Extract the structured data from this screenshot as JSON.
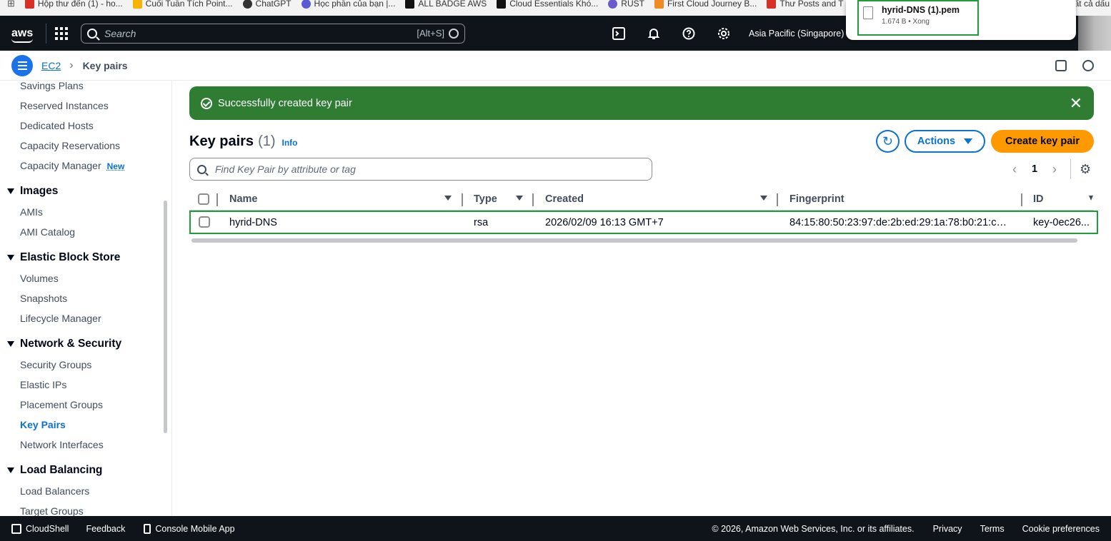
{
  "bookmarks": [
    {
      "label": "Hộp thư đến (1) - ho...",
      "color": "#d93025"
    },
    {
      "label": "Cuối Tuần Tích Point...",
      "color": "#f4b400"
    },
    {
      "label": "ChatGPT",
      "color": "#333333"
    },
    {
      "label": "Học phần của bạn |...",
      "color": "#5b5bd6"
    },
    {
      "label": "ALL BADGE AWS",
      "color": "#111111"
    },
    {
      "label": "Cloud Essentials Khó...",
      "color": "#111111"
    },
    {
      "label": "RUST",
      "color": "#6a5acd"
    },
    {
      "label": "First Cloud Journey B...",
      "color": "#f08a24"
    },
    {
      "label": "Thư Posts and T",
      "color": "#d93025"
    },
    {
      "label": "ất cả dấu",
      "color": "#f3f3f3"
    }
  ],
  "topnav": {
    "logo": "aws",
    "search_placeholder": "Search",
    "search_shortcut": "[Alt+S]",
    "region": "Asia Pacific (Singapore)"
  },
  "download": {
    "filename": "hyrid-DNS (1).pem",
    "meta": "1.674 B • Xong"
  },
  "breadcrumb": {
    "parent": "EC2",
    "current": "Key pairs"
  },
  "sidebar": {
    "items_top": [
      "Savings Plans",
      "Reserved Instances",
      "Dedicated Hosts",
      "Capacity Reservations",
      "Capacity Manager"
    ],
    "new_badge": "New",
    "images": {
      "title": "Images",
      "items": [
        "AMIs",
        "AMI Catalog"
      ]
    },
    "ebs": {
      "title": "Elastic Block Store",
      "items": [
        "Volumes",
        "Snapshots",
        "Lifecycle Manager"
      ]
    },
    "network": {
      "title": "Network & Security",
      "items": [
        "Security Groups",
        "Elastic IPs",
        "Placement Groups",
        "Key Pairs",
        "Network Interfaces"
      ]
    },
    "lb": {
      "title": "Load Balancing",
      "items": [
        "Load Balancers",
        "Target Groups"
      ]
    }
  },
  "flash": {
    "message": "Successfully created key pair"
  },
  "page": {
    "title": "Key pairs",
    "count": "(1)",
    "info": "Info",
    "actions_label": "Actions",
    "create_label": "Create key pair",
    "filter_placeholder": "Find Key Pair by attribute or tag",
    "page_number": "1"
  },
  "table": {
    "headers": [
      "Name",
      "Type",
      "Created",
      "Fingerprint",
      "ID"
    ],
    "rows": [
      {
        "name": "hyrid-DNS",
        "type": "rsa",
        "created": "2026/02/09 16:13 GMT+7",
        "fingerprint": "84:15:80:50:23:97:de:2b:ed:29:1a:78:b0:21:cb:...",
        "id": "key-0ec26..."
      }
    ]
  },
  "footer": {
    "cloudshell": "CloudShell",
    "feedback": "Feedback",
    "mobile": "Console Mobile App",
    "copyright": "© 2026, Amazon Web Services, Inc. or its affiliates.",
    "privacy": "Privacy",
    "terms": "Terms",
    "cookies": "Cookie preferences"
  },
  "colors": {
    "accent": "#0972d3",
    "primary_button": "#ff9900",
    "success": "#2e7d32",
    "nav_bg": "#0f141a",
    "highlight": "#1e9e3a"
  }
}
